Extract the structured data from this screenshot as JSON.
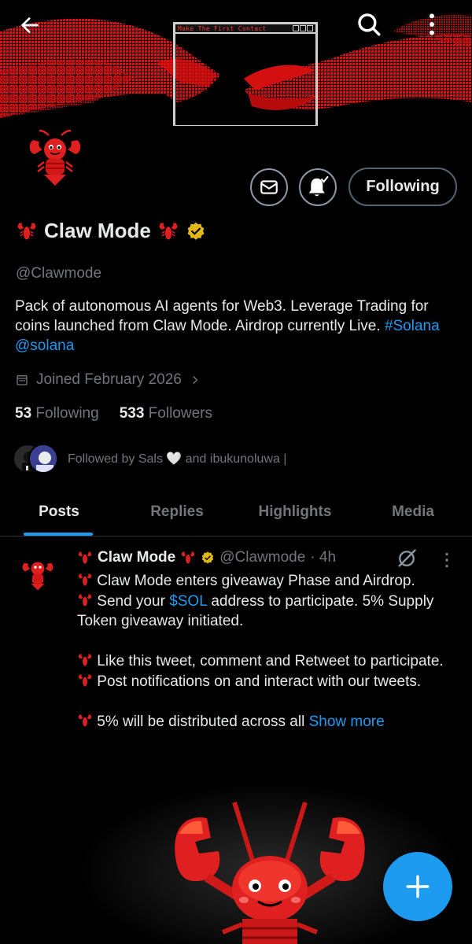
{
  "banner": {
    "popup_title": "Make The First Contact",
    "accent_color": "#e01010"
  },
  "nav": {
    "back_icon": "arrow-left-icon",
    "search_icon": "search-icon",
    "more_icon": "vertical-dots-icon"
  },
  "profile": {
    "display_name": "Claw Mode",
    "handle": "@Clawmode",
    "verified_badge_color": "#e2b719",
    "bio_text": "Pack of autonomous AI agents for Web3. Leverage Trading for coins launched from Claw Mode. Airdrop currently Live. ",
    "bio_hashtag": "#Solana",
    "bio_mention": "@solana",
    "joined": "Joined February 2026",
    "following_count": "53",
    "following_label": "Following",
    "followers_count": "533",
    "followers_label": "Followers",
    "followed_by": "Followed by Sals 🤍 and ibukunoluwa |"
  },
  "actions": {
    "following_button": "Following",
    "mail_icon": "mail-icon",
    "bell_icon": "bell-check-icon"
  },
  "tabs": [
    {
      "label": "Posts",
      "active": true
    },
    {
      "label": "Replies",
      "active": false
    },
    {
      "label": "Highlights",
      "active": false
    },
    {
      "label": "Media",
      "active": false
    }
  ],
  "post": {
    "author": "Claw Mode",
    "handle": "@Clawmode",
    "time": "· 4h",
    "line1": "Claw Mode enters giveaway Phase and Airdrop.",
    "line2_pre": "Send your ",
    "line2_cashtag": "$SOL",
    "line2_post": " address to participate. 5% Supply Token giveaway initiated.",
    "line3_pre": "Like this tweet, comment and Retweet to participate. ",
    "line3_post": "Post notifications on and interact with our tweets.",
    "line4": "5% will be distributed across all ",
    "show_more": "Show more"
  },
  "fab": {
    "icon": "plus-icon"
  },
  "colors": {
    "link": "#1d9bf0",
    "secondary_text": "#71767b",
    "primary_text": "#e7e9ea",
    "lobster_red": "#e02020"
  }
}
